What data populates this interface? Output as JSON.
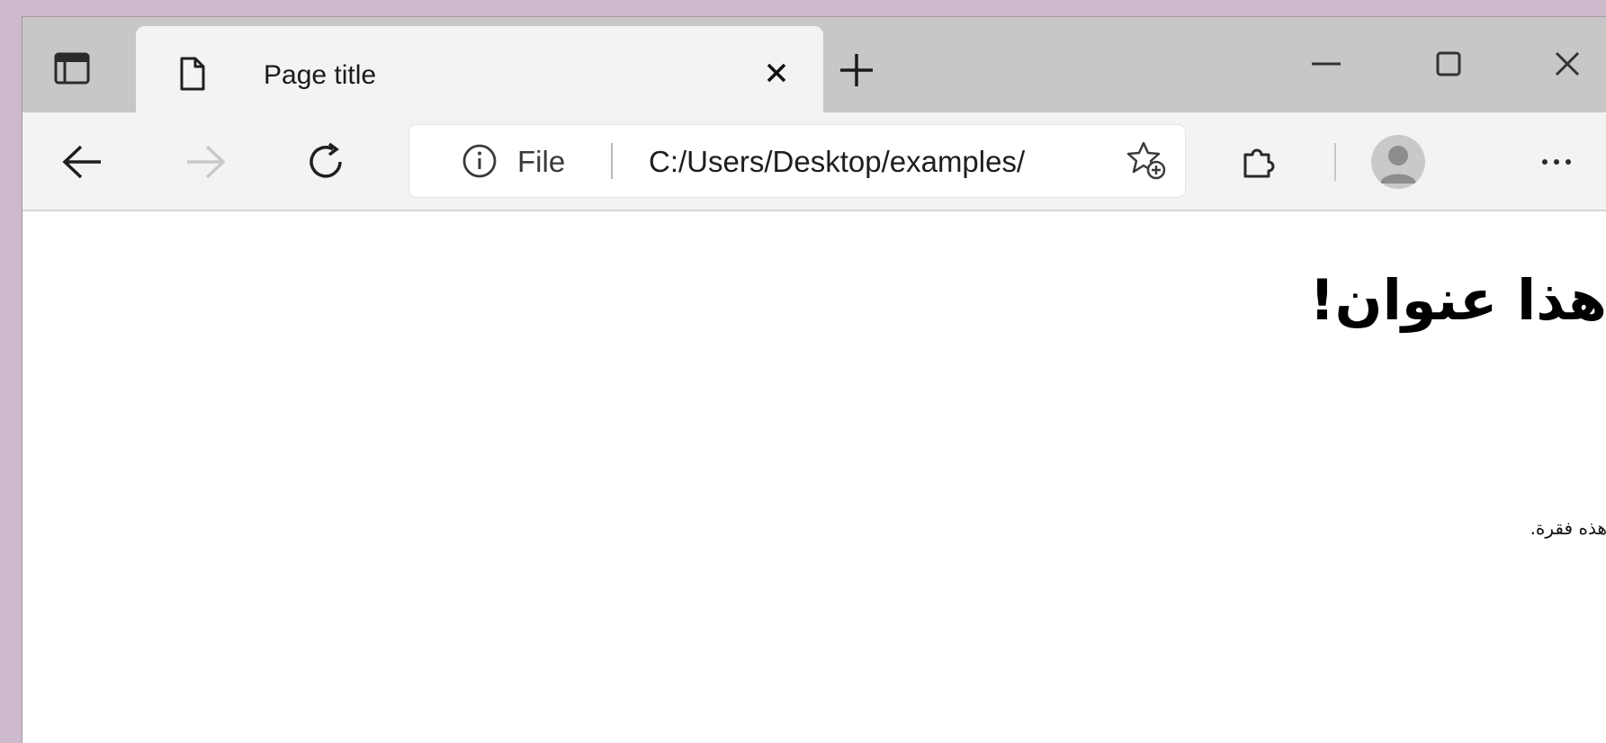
{
  "tab": {
    "title": "Page title",
    "close_icon": "close-icon",
    "page_icon": "document-icon"
  },
  "tabbar": {
    "tab_actions_icon": "tab-actions-icon",
    "new_tab_icon": "plus-icon"
  },
  "window_controls": {
    "minimize_icon": "minimize-icon",
    "maximize_icon": "maximize-icon",
    "close_icon": "close-icon"
  },
  "toolbar": {
    "back_icon": "arrow-left-icon",
    "forward_icon": "arrow-right-icon",
    "refresh_icon": "refresh-icon",
    "extensions_icon": "extensions-icon",
    "profile_icon": "avatar",
    "more_icon": "more-icon",
    "more_label": "···"
  },
  "address_bar": {
    "site_info_icon": "info-icon",
    "site_label": "File",
    "url": "C:/Users/Desktop/examples/",
    "favorite_icon": "add-favorite-icon"
  },
  "page": {
    "heading": "هذا عنوان!",
    "paragraph": "هذه فقرة."
  },
  "colors": {
    "desktop": "#cdb9cc",
    "tabbar": "#c8c6c6",
    "toolbar": "#f3f3f3",
    "page": "#ffffff"
  }
}
